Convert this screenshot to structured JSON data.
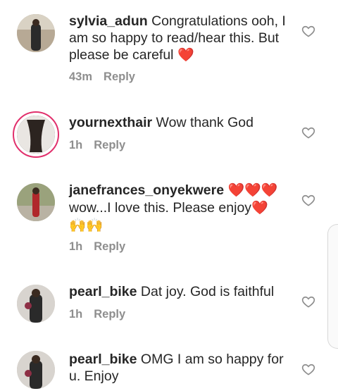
{
  "comments": [
    {
      "username": "sylvia_adun",
      "text_before": "Congratulations ooh, I am so happy to read/hear this. But please be careful ",
      "emoji": "❤️",
      "time": "43m",
      "reply": "Reply"
    },
    {
      "username": "yournexthair",
      "text_before": "Wow thank God",
      "emoji": "",
      "time": "1h",
      "reply": "Reply"
    },
    {
      "username": "janefrances_onyekwere",
      "text_before": " ",
      "emoji_after_user": "❤️❤️❤️",
      "text_line2": "wow...I love this. Please enjoy",
      "emoji": "❤️",
      "text_line3": "🙌🙌",
      "time": "1h",
      "reply": "Reply"
    },
    {
      "username": "pearl_bike",
      "text_before": "Dat joy. God is faithful",
      "emoji": "",
      "time": "1h",
      "reply": "Reply"
    },
    {
      "username": "pearl_bike",
      "text_before": "OMG I am so happy for u. Enjoy",
      "emoji": "",
      "time": "",
      "reply": ""
    }
  ],
  "icons": {
    "like": "heart-outline-icon"
  },
  "colors": {
    "accent_heart": "#e0202f",
    "meta_gray": "#8e8e8e",
    "story_ring": "#e1306c"
  }
}
